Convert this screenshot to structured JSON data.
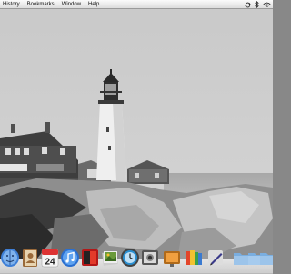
{
  "menubar": {
    "menus": [
      "History",
      "Bookmarks",
      "Window",
      "Help"
    ],
    "status_icons": [
      "sync-icon",
      "bluetooth-icon",
      "wifi-icon"
    ]
  },
  "desktop": {
    "wallpaper": "grayscale-lighthouse-coast-photo"
  },
  "dock": {
    "items": [
      {
        "name": "finder-icon",
        "label": ""
      },
      {
        "name": "address-book-icon",
        "label": ""
      },
      {
        "name": "calendar-icon",
        "label": "24"
      },
      {
        "name": "itunes-icon",
        "label": ""
      },
      {
        "name": "photo-booth-icon",
        "label": ""
      },
      {
        "name": "iphoto-icon",
        "label": ""
      },
      {
        "name": "time-machine-icon",
        "label": ""
      },
      {
        "name": "photo-viewer-icon",
        "label": ""
      },
      {
        "name": "slideshow-icon",
        "label": ""
      },
      {
        "name": "app-store-icon",
        "label": ""
      },
      {
        "name": "preview-pen-icon",
        "label": ""
      },
      {
        "name": "applications-folder-icon",
        "label": ""
      },
      {
        "name": "documents-folder-icon",
        "label": ""
      },
      {
        "name": "downloads-folder-icon",
        "label": ""
      }
    ]
  },
  "colors": {
    "menubar": "#e9e9e9",
    "sky": "#cfcfcf",
    "rock": "#bdbdbd",
    "building": "#5a5a5a"
  }
}
